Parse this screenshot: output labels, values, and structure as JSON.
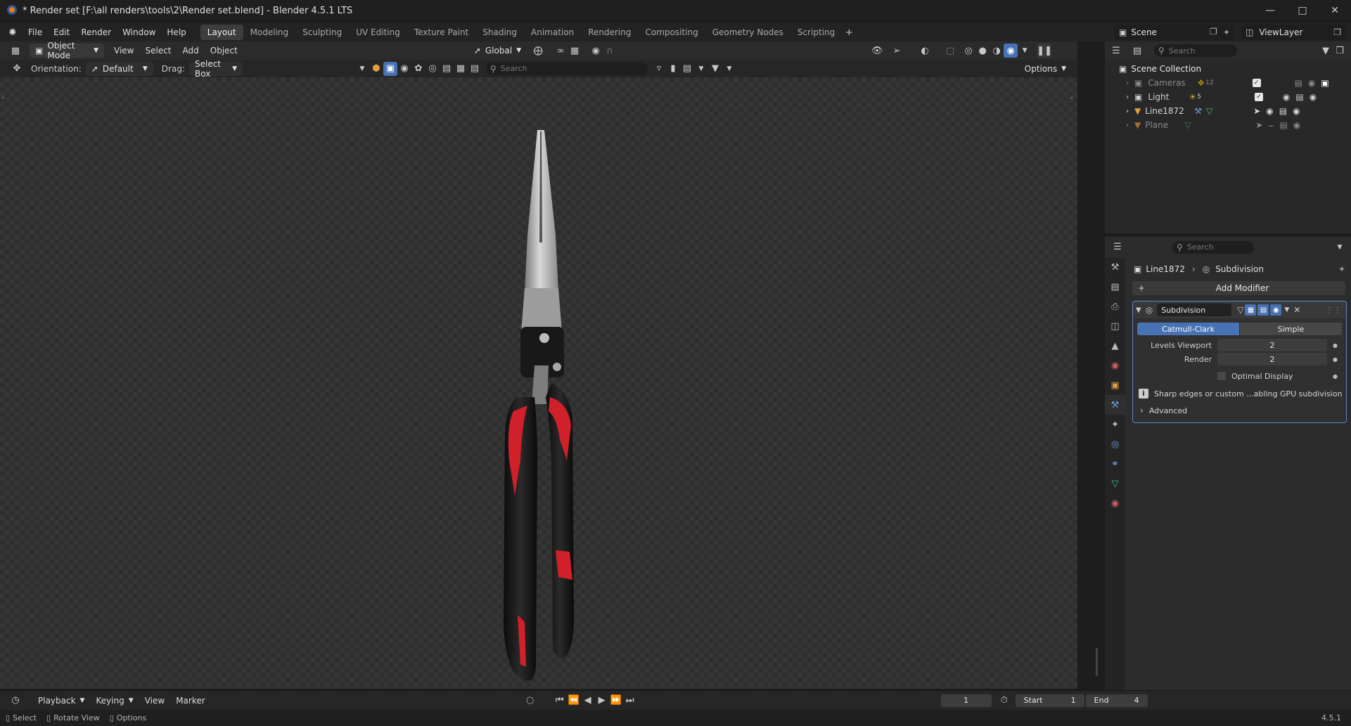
{
  "window": {
    "title": "* Render set [F:\\all renders\\tools\\2\\Render set.blend] - Blender 4.5.1 LTS"
  },
  "menu": [
    "File",
    "Edit",
    "Render",
    "Window",
    "Help"
  ],
  "workspaces": [
    "Layout",
    "Modeling",
    "Sculpting",
    "UV Editing",
    "Texture Paint",
    "Shading",
    "Animation",
    "Rendering",
    "Compositing",
    "Geometry Nodes",
    "Scripting"
  ],
  "scene": {
    "name": "Scene",
    "view_layer": "ViewLayer"
  },
  "viewport_header": {
    "mode": "Object Mode",
    "menus": [
      "View",
      "Select",
      "Add",
      "Object"
    ],
    "transform": "Global"
  },
  "tool_header": {
    "orientation_label": "Orientation:",
    "orientation_value": "Default",
    "drag_label": "Drag:",
    "drag_value": "Select Box",
    "search_placeholder": "Search",
    "options_label": "Options"
  },
  "outliner": {
    "search_placeholder": "Search",
    "root": "Scene Collection",
    "items": [
      {
        "name": "Cameras",
        "badge": "12"
      },
      {
        "name": "Light",
        "badge": "5"
      },
      {
        "name": "Line1872",
        "badge": ""
      },
      {
        "name": "Plane",
        "badge": ""
      }
    ]
  },
  "properties": {
    "search_placeholder": "Search",
    "breadcrumb_object": "Line1872",
    "breadcrumb_modifier": "Subdivision",
    "add_modifier": "Add Modifier",
    "modifier": {
      "name": "Subdivision",
      "type_a": "Catmull-Clark",
      "type_b": "Simple",
      "levels_viewport_label": "Levels Viewport",
      "levels_viewport_value": "2",
      "render_label": "Render",
      "render_value": "2",
      "optimal_display_label": "Optimal Display",
      "info_text": "Sharp edges or custom ...abling GPU subdivision",
      "advanced_label": "Advanced"
    }
  },
  "timeline": {
    "menus": [
      "Playback",
      "Keying",
      "View",
      "Marker"
    ],
    "current_frame": "1",
    "start_label": "Start",
    "start_value": "1",
    "end_label": "End",
    "end_value": "4"
  },
  "status": {
    "select": "Select",
    "rotate": "Rotate View",
    "options": "Options",
    "version": "4.5.1"
  },
  "colors": {
    "accent_blue": "#4772b3",
    "active_border": "#5a8ad1",
    "pliers_red": "#d0202a"
  }
}
